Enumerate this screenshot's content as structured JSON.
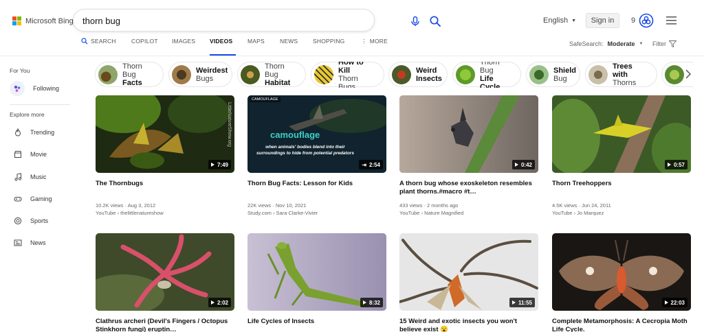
{
  "header": {
    "logo_text": "Microsoft Bing",
    "search_value": "thorn bug",
    "language": "English",
    "signin_label": "Sign in",
    "rewards_count": "9"
  },
  "nav": {
    "items": [
      {
        "label": "SEARCH",
        "active": false
      },
      {
        "label": "COPILOT",
        "active": false
      },
      {
        "label": "IMAGES",
        "active": false
      },
      {
        "label": "VIDEOS",
        "active": true
      },
      {
        "label": "MAPS",
        "active": false
      },
      {
        "label": "NEWS",
        "active": false
      },
      {
        "label": "SHOPPING",
        "active": false
      },
      {
        "label": "MORE",
        "active": false
      }
    ],
    "safesearch_label": "SafeSearch:",
    "safesearch_value": "Moderate",
    "filter_label": "Filter"
  },
  "sidebar": {
    "for_you": "For You",
    "following": "Following",
    "explore_more": "Explore more",
    "items": [
      "Trending",
      "Movie",
      "Music",
      "Gaming",
      "Sports",
      "News"
    ]
  },
  "chips": [
    {
      "line1": "Thorn Bug",
      "line2": "Facts",
      "bold": 2
    },
    {
      "line1": "Weirdest",
      "line2": "Bugs",
      "bold": 1
    },
    {
      "line1": "Thorn Bug",
      "line2": "Habitat",
      "bold": 2
    },
    {
      "line1": "How to Kill",
      "line2": "Thorn Bugs",
      "bold": 1
    },
    {
      "line1": "Weird",
      "line2": "Insects",
      "bold": 0
    },
    {
      "line1": "Thorn Bug",
      "line2": "Life Cycle",
      "bold": 2
    },
    {
      "line1": "Shield",
      "line2": "Bug",
      "bold": 1
    },
    {
      "line1": "Trees with",
      "line2": "Thorns",
      "bold": 1
    }
  ],
  "videos": [
    {
      "title": "The Thornbugs",
      "duration": "7:49",
      "views": "10.2K views",
      "date": "Aug 3, 2012",
      "source": "YouTube",
      "channel": "thelittlenatureshow",
      "watermark": "LittleNatureShow.org"
    },
    {
      "title": "Thorn Bug Facts: Lesson for Kids",
      "duration": "2:54",
      "views": "22K views",
      "date": "Nov 10, 2021",
      "source": "Study.com",
      "channel": "Sara Clarke-Vivier",
      "badge": "CAMOUFLAGE",
      "overlay_title": "camouflage",
      "overlay_text": "when animals' bodies blend into their surroundings to hide from potential predators"
    },
    {
      "title": "A thorn bug whose exoskeleton resembles plant thorns.#macro #t…",
      "duration": "0:42",
      "views": "433 views",
      "date": "2 months ago",
      "source": "YouTube",
      "channel": "Nature Magnified"
    },
    {
      "title": "Thorn Treehoppers",
      "duration": "0:57",
      "views": "4.5K views",
      "date": "Jun 24, 2011",
      "source": "YouTube",
      "channel": "Jo Marquez"
    },
    {
      "title": "Clathrus archeri (Devil's Fingers / Octopus Stinkhorn fungi) eruptin…",
      "duration": "2:02"
    },
    {
      "title": "Life Cycles of Insects",
      "duration": "8:32"
    },
    {
      "title": "15 Weird and exotic insects you won't believe exist 😮",
      "duration": "11:55"
    },
    {
      "title": "Complete Metamorphosis: A Cecropia Moth Life Cycle.",
      "duration": "22:03"
    }
  ],
  "colors": {
    "accent": "#174ae4",
    "logo_red": "#f25022",
    "logo_green": "#7fba00",
    "logo_blue": "#00a4ef",
    "logo_yellow": "#ffb900"
  },
  "icons": {
    "mic": "microphone-icon",
    "search": "search-icon",
    "rewards": "rewards-icon",
    "menu": "hamburger-menu-icon"
  }
}
